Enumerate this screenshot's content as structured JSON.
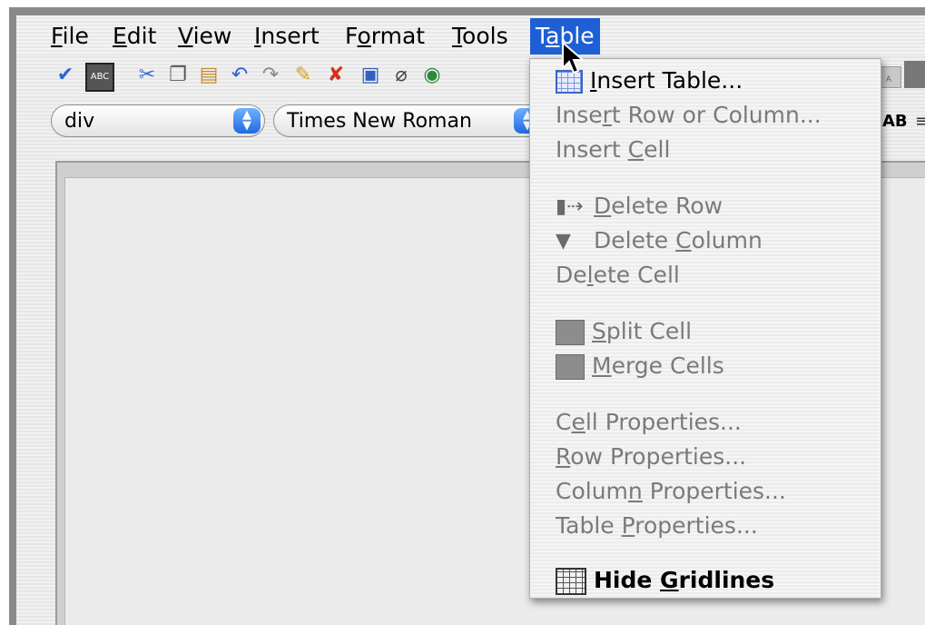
{
  "menubar": {
    "items": [
      {
        "label": "File",
        "ul": "F",
        "rest": "ile"
      },
      {
        "label": "Edit",
        "ul": "E",
        "rest": "dit"
      },
      {
        "label": "View",
        "ul": "V",
        "rest": "iew"
      },
      {
        "label": "Insert",
        "ul": "I",
        "rest": "nsert"
      },
      {
        "label": "Format",
        "pre": "F",
        "ul": "o",
        "rest": "rmat"
      },
      {
        "label": "Tools",
        "ul": "T",
        "rest": "ools"
      },
      {
        "label": "Table",
        "pre": "T",
        "ul": "a",
        "rest": "ble"
      }
    ]
  },
  "formatbar": {
    "paragraph_style": "div",
    "font_family": "Times New Roman",
    "bold_glyph": "AB"
  },
  "table_menu": {
    "items": [
      {
        "pre": "",
        "ul": "I",
        "rest": "nsert Table...",
        "enabled": true,
        "icon": "table-grid-icon"
      },
      {
        "pre": "Inse",
        "ul": "r",
        "rest": "t Row or Column...",
        "enabled": false
      },
      {
        "pre": "Insert ",
        "ul": "C",
        "rest": "ell",
        "enabled": false
      },
      {
        "pre": "",
        "ul": "D",
        "rest": "elete Row",
        "enabled": false,
        "icon": "delete-row-icon"
      },
      {
        "pre": "Delete ",
        "ul": "C",
        "rest": "olumn",
        "enabled": false,
        "icon": "delete-column-icon"
      },
      {
        "pre": "De",
        "ul": "l",
        "rest": "ete Cell",
        "enabled": false
      },
      {
        "pre": "",
        "ul": "S",
        "rest": "plit Cell",
        "enabled": false,
        "icon": "split-cell-icon"
      },
      {
        "pre": "",
        "ul": "M",
        "rest": "erge Cells",
        "enabled": false,
        "icon": "merge-cells-icon"
      },
      {
        "pre": "C",
        "ul": "e",
        "rest": "ll Properties...",
        "enabled": false
      },
      {
        "pre": "",
        "ul": "R",
        "rest": "ow Properties...",
        "enabled": false
      },
      {
        "pre": "Colum",
        "ul": "n",
        "rest": " Properties...",
        "enabled": false
      },
      {
        "pre": "Table ",
        "ul": "P",
        "rest": "roperties...",
        "enabled": false
      },
      {
        "pre": "Hide ",
        "ul": "G",
        "rest": "ridlines",
        "enabled": true,
        "icon": "gridlines-icon"
      }
    ]
  }
}
